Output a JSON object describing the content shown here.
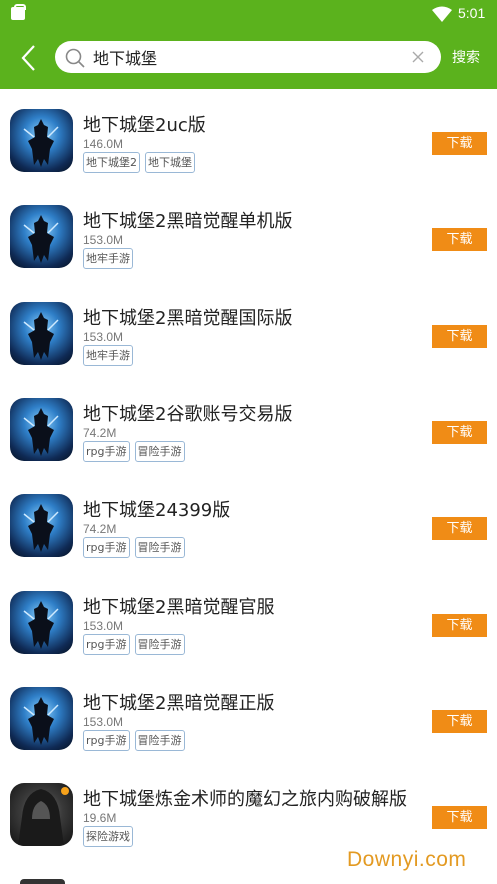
{
  "status": {
    "time": "5:01"
  },
  "search": {
    "query": "地下城堡",
    "button_label": "搜索"
  },
  "results": [
    {
      "title": "地下城堡2uc版",
      "size": "146.0M",
      "tags": [
        "地下城堡2",
        "地下城堡"
      ],
      "download": "下载",
      "icon": "game-knight-icon"
    },
    {
      "title": "地下城堡2黑暗觉醒单机版",
      "size": "153.0M",
      "tags": [
        "地牢手游"
      ],
      "download": "下载",
      "icon": "game-knight-icon"
    },
    {
      "title": "地下城堡2黑暗觉醒国际版",
      "size": "153.0M",
      "tags": [
        "地牢手游"
      ],
      "download": "下载",
      "icon": "game-knight-icon"
    },
    {
      "title": "地下城堡2谷歌账号交易版",
      "size": "74.2M",
      "tags": [
        "rpg手游",
        "冒险手游"
      ],
      "download": "下载",
      "icon": "game-knight-icon"
    },
    {
      "title": "地下城堡24399版",
      "size": "74.2M",
      "tags": [
        "rpg手游",
        "冒险手游"
      ],
      "download": "下载",
      "icon": "game-knight-icon"
    },
    {
      "title": "地下城堡2黑暗觉醒官服",
      "size": "153.0M",
      "tags": [
        "rpg手游",
        "冒险手游"
      ],
      "download": "下载",
      "icon": "game-knight-icon"
    },
    {
      "title": "地下城堡2黑暗觉醒正版",
      "size": "153.0M",
      "tags": [
        "rpg手游",
        "冒险手游"
      ],
      "download": "下载",
      "icon": "game-knight-icon"
    },
    {
      "title": "地下城堡炼金术师的魔幻之旅内购破解版",
      "size": "19.6M",
      "tags": [
        "探险游戏"
      ],
      "download": "下载",
      "icon": "game-hooded-icon"
    }
  ],
  "watermark": "Downyi.com",
  "colors": {
    "theme": "#5bb21d",
    "download": "#f08c16"
  }
}
